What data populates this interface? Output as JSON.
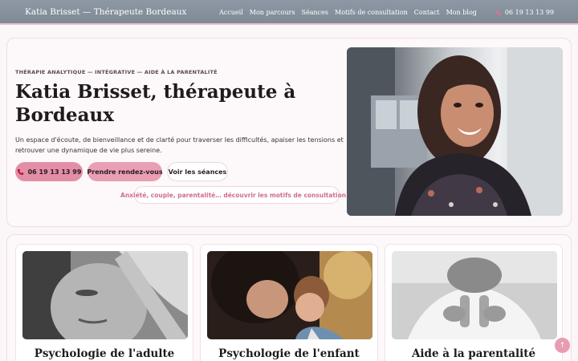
{
  "header": {
    "brand": "Katia Brisset — Thérapeute Bordeaux",
    "nav": [
      "Accueil",
      "Mon parcours",
      "Séances",
      "Motifs de consultation",
      "Contact",
      "Mon blog"
    ],
    "phone": "06 19 13 13 99"
  },
  "hero": {
    "kicker": "THÉRAPIE ANALYTIQUE — INTÉGRATIVE — AIDE À LA PARENTALITÉ",
    "title": "Katia Brisset, thérapeute à Bordeaux",
    "lead": "Un espace d'écoute, de bienveillance et de clarté pour traverser les difficultés, apaiser les tensions et retrouver une dynamique de vie plus sereine.",
    "phone_button": "06 19 13 13 99",
    "rdv_button": "Prendre rendez-vous",
    "seances_button": "Voir les séances",
    "motifs_link": "Anxiété, couple, parentalité… découvrir les motifs de consultation →"
  },
  "cards": [
    {
      "title": "Psychologie de l'adulte"
    },
    {
      "title": "Psychologie de l'enfant"
    },
    {
      "title": "Aide à la parentalité"
    }
  ],
  "back_to_top": "↑",
  "colors": {
    "accent": "#e38ea7",
    "header": "#8e98a4",
    "link": "#cf6e8c"
  }
}
